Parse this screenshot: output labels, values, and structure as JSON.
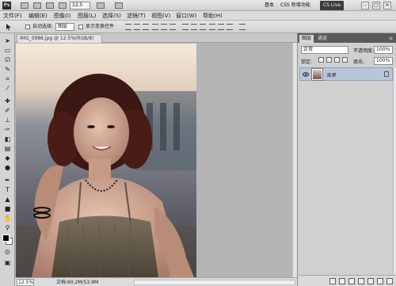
{
  "app": {
    "logo": "Ps",
    "zoom": "12.5",
    "essentials": "基本",
    "cs_live": "CSS 新增功能",
    "workspace": "CS Live",
    "window_controls": [
      "minimize-icon",
      "maximize-icon",
      "close-icon"
    ]
  },
  "menu": [
    "文件(F)",
    "编辑(E)",
    "图像(I)",
    "图层(L)",
    "选择(S)",
    "滤镜(T)",
    "视图(V)",
    "窗口(W)",
    "帮助(H)"
  ],
  "options": {
    "auto_select_label": "自动选择:",
    "auto_select_value": "图层",
    "show_transform_label": "显示变换控件"
  },
  "document": {
    "tab_title": "IMG_0986.jpg @ 12.5%(RGB/8)",
    "zoom": "12.5%",
    "info": "文档:60.2M/53.9M"
  },
  "panels": {
    "tabs": [
      "图层",
      "通道"
    ],
    "blend_mode": "正常",
    "opacity_label": "不透明度:",
    "opacity_value": "100%",
    "lock_label": "锁定:",
    "fill_label": "填充:",
    "fill_value": "100%",
    "layer_name": "背景"
  },
  "colors": {
    "selection": "#b9c6d9",
    "workspace_dark": "#3c3c3c"
  },
  "icons": {
    "tools": [
      "move-tool-icon",
      "marquee-tool-icon",
      "lasso-tool-icon",
      "quick-select-icon",
      "crop-tool-icon",
      "eyedropper-icon",
      "healing-brush-icon",
      "brush-tool-icon",
      "clone-stamp-icon",
      "history-brush-icon",
      "eraser-icon",
      "gradient-icon",
      "blur-tool-icon",
      "dodge-tool-icon",
      "pen-tool-icon",
      "type-tool-icon",
      "path-select-icon",
      "shape-tool-icon",
      "hand-tool-icon",
      "zoom-tool-icon",
      "rotate-view-icon",
      "quick-mask-icon"
    ]
  }
}
